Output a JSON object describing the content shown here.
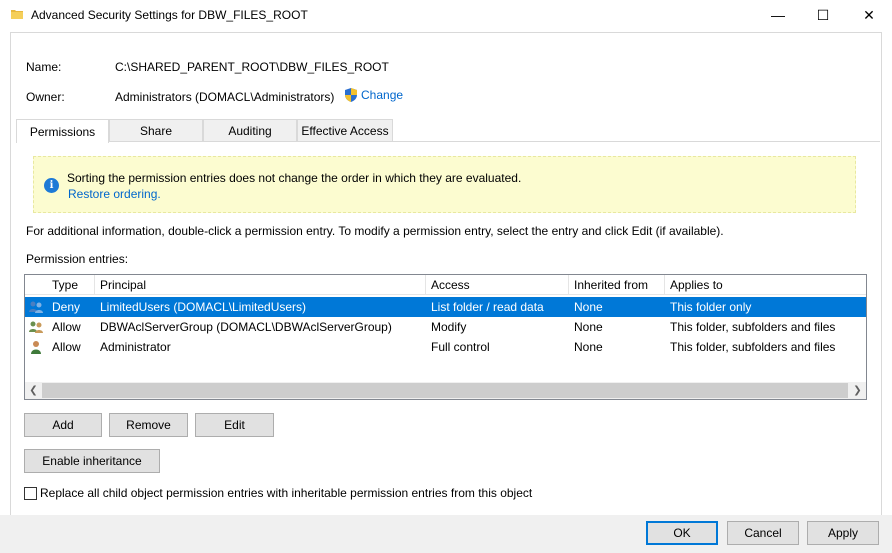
{
  "window": {
    "title": "Advanced Security Settings for DBW_FILES_ROOT",
    "minimize_glyph": "—",
    "maximize_glyph": "☐",
    "close_glyph": "✕"
  },
  "info": {
    "name_label": "Name:",
    "name_value": "C:\\SHARED_PARENT_ROOT\\DBW_FILES_ROOT",
    "owner_label": "Owner:",
    "owner_value": "Administrators (DOMACL\\Administrators)",
    "change_label": "Change"
  },
  "tabs": [
    {
      "label": "Permissions",
      "active": true
    },
    {
      "label": "Share",
      "active": false
    },
    {
      "label": "Auditing",
      "active": false
    },
    {
      "label": "Effective Access",
      "active": false
    }
  ],
  "banner": {
    "icon": "info-icon",
    "text": "Sorting the permission entries does not change the order in which they are evaluated.",
    "link": "Restore ordering."
  },
  "hint": "For additional information, double-click a permission entry. To modify a permission entry, select the entry and click Edit (if available).",
  "entries_label": "Permission entries:",
  "grid": {
    "columns": [
      "Type",
      "Principal",
      "Access",
      "Inherited from",
      "Applies to"
    ],
    "rows": [
      {
        "icon": "user-group-icon",
        "type": "Deny",
        "principal": "LimitedUsers (DOMACL\\LimitedUsers)",
        "access": "List folder / read data",
        "inherited": "None",
        "applies": "This folder only",
        "selected": true
      },
      {
        "icon": "user-group-icon",
        "type": "Allow",
        "principal": "DBWAclServerGroup (DOMACL\\DBWAclServerGroup)",
        "access": "Modify",
        "inherited": "None",
        "applies": "This folder, subfolders and files",
        "selected": false
      },
      {
        "icon": "user-icon",
        "type": "Allow",
        "principal": "Administrator",
        "access": "Full control",
        "inherited": "None",
        "applies": "This folder, subfolders and files",
        "selected": false
      }
    ]
  },
  "buttons": {
    "add": "Add",
    "remove": "Remove",
    "edit": "Edit",
    "enable_inheritance": "Enable inheritance",
    "ok": "OK",
    "cancel": "Cancel",
    "apply": "Apply"
  },
  "replace_checkbox": {
    "label": "Replace all child object permission entries with inheritable permission entries from this object",
    "checked": false
  },
  "colors": {
    "selection": "#0078d7",
    "link": "#0066cc",
    "banner_bg": "#fcfcd0",
    "footer_bg": "#f0f0f0"
  }
}
